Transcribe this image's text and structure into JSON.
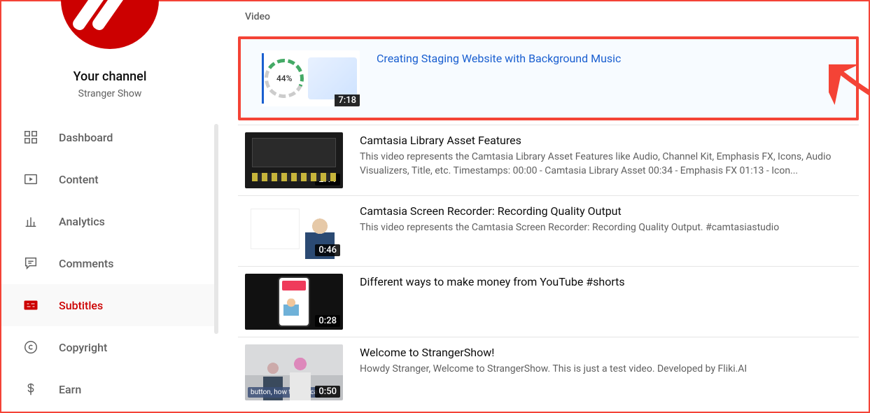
{
  "channel": {
    "heading": "Your channel",
    "name": "Stranger Show"
  },
  "nav": {
    "dashboard": "Dashboard",
    "content": "Content",
    "analytics": "Analytics",
    "comments": "Comments",
    "subtitles": "Subtitles",
    "copyright": "Copyright",
    "earn": "Earn"
  },
  "columnHeader": "Video",
  "videos": [
    {
      "title": "Creating Staging Website with Background Music",
      "duration": "7:18",
      "progress": "44%",
      "description": ""
    },
    {
      "title": "Camtasia Library Asset Features",
      "duration": "2:11",
      "description": "This video represents the Camtasia Library Asset Features like Audio, Channel Kit, Emphasis FX, Icons, Audio Visualizers, Title, etc. Timestamps: 00:00 - Camtasia Library Asset 00:34 - Emphasis FX 01:13 - Icon..."
    },
    {
      "title": "Camtasia Screen Recorder: Recording Quality Output",
      "duration": "0:46",
      "description": "This video represents the Camtasia Screen Recorder: Recording Quality Output. #camtasiastudio"
    },
    {
      "title": "Different ways to make money from YouTube #shorts",
      "duration": "0:28",
      "description": ""
    },
    {
      "title": "Welcome to StrangerShow!",
      "duration": "0:50",
      "chip": "button, how to add-ca",
      "description": "Howdy Stranger, Welcome to StrangerShow. This is just a test video. Developed by Fliki.AI"
    }
  ]
}
